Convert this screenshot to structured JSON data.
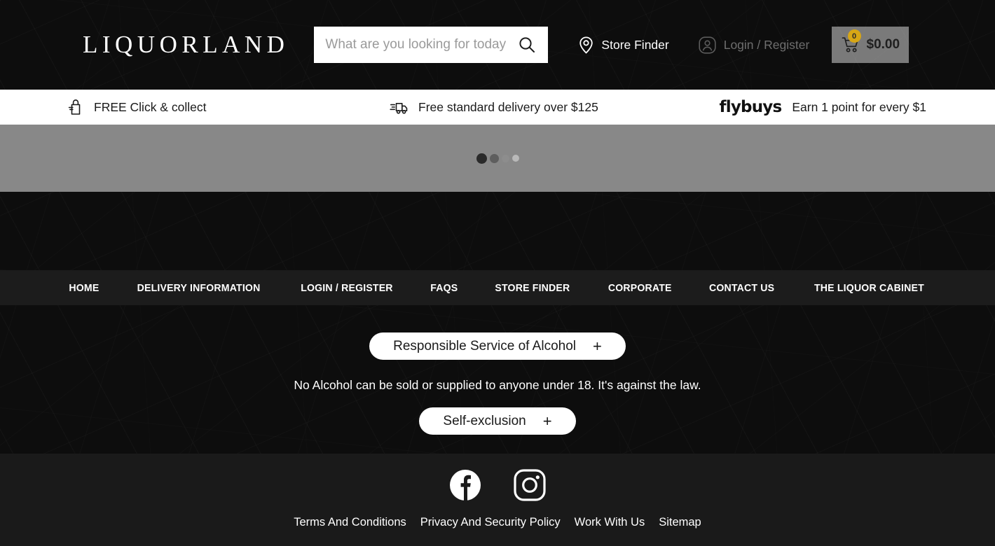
{
  "header": {
    "logo_text": "LIQUORLAND",
    "search": {
      "placeholder": "What are you looking for today",
      "value": "",
      "icon": "search-icon"
    },
    "store_finder": {
      "label": "Store Finder",
      "icon": "location-pin-icon"
    },
    "login_register": {
      "label": "Login / Register",
      "icon": "user-account-icon"
    },
    "cart": {
      "count": "0",
      "total": "$0.00",
      "icon": "shopping-cart-icon"
    }
  },
  "promo_bar": {
    "items": [
      {
        "label": "FREE Click & collect",
        "icon": "click-and-collect-icon"
      },
      {
        "label": "Free standard delivery over $125",
        "icon": "delivery-truck-icon"
      },
      {
        "brand": "flybuys",
        "label": "Earn 1 point for every $1",
        "icon": "flybuys-logo"
      }
    ]
  },
  "loading": {
    "state": "loading",
    "dots": [
      "#2a2a2a",
      "#5e5e5e",
      "#8d8d8d",
      "#b9b9b9"
    ],
    "background": "#888888"
  },
  "nav": {
    "items": [
      {
        "label": "HOME"
      },
      {
        "label": "DELIVERY INFORMATION"
      },
      {
        "label": "LOGIN / REGISTER"
      },
      {
        "label": "FAQS"
      },
      {
        "label": "STORE FINDER"
      },
      {
        "label": "CORPORATE"
      },
      {
        "label": "CONTACT US"
      },
      {
        "label": "THE LIQUOR CABINET"
      }
    ]
  },
  "legal": {
    "rsa_button": {
      "label": "Responsible Service of Alcohol",
      "expander": "+"
    },
    "notice": "No Alcohol can be sold or supplied to anyone under 18. It's against the law.",
    "self_exclusion_button": {
      "label": "Self-exclusion",
      "expander": "+"
    }
  },
  "footer": {
    "socials": [
      {
        "name": "facebook-icon",
        "label": "Facebook"
      },
      {
        "name": "instagram-icon",
        "label": "Instagram"
      }
    ],
    "links": [
      {
        "label": "Terms And Conditions"
      },
      {
        "label": "Privacy And Security Policy"
      },
      {
        "label": "Work With Us"
      },
      {
        "label": "Sitemap"
      }
    ]
  },
  "colors": {
    "page_background": "#0d0d0d",
    "nav_background": "#1c1c1c",
    "footer_background": "#1a1a1a",
    "promo_background": "#ffffff",
    "loading_background": "#888888",
    "cart_badge": "#d7a615",
    "text_light": "#ffffff",
    "text_muted": "#6e6e6e"
  }
}
